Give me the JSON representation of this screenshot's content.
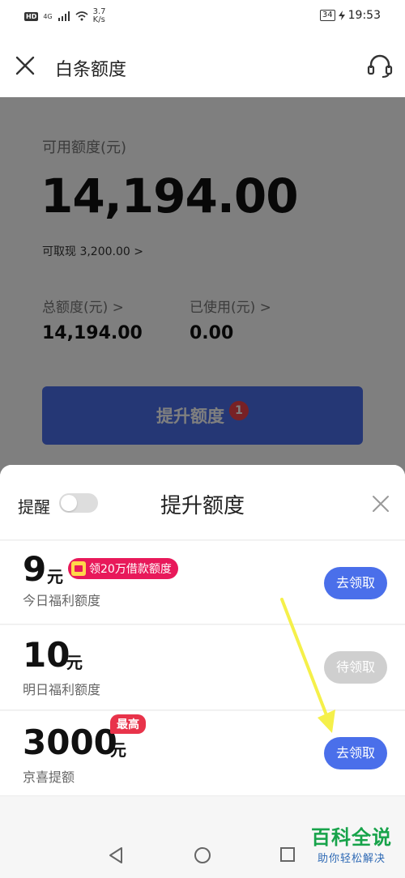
{
  "status_bar": {
    "hd": "HD",
    "network": "4G",
    "speed_value": "3.7",
    "speed_unit": "K/s",
    "battery": "34",
    "time": "19:53"
  },
  "header": {
    "title": "白条额度",
    "close_icon": "close-icon",
    "service_icon": "headset-icon"
  },
  "account": {
    "available_label": "可用额度(元)",
    "available_amount": "14,194.00",
    "cash_label": "可取现 3,200.00 >",
    "total_label": "总额度(元) >",
    "total_value": "14,194.00",
    "used_label": "已使用(元) >",
    "used_value": "0.00",
    "raise_button": "提升额度",
    "raise_badge": "1"
  },
  "sheet": {
    "remind_label": "提醒",
    "remind_on": false,
    "title": "提升额度",
    "rows": [
      {
        "amount": "9",
        "unit": "元",
        "tag": "领20万借款额度",
        "desc": "今日福利额度",
        "button": "去领取",
        "state": "active"
      },
      {
        "amount": "10",
        "unit": "元",
        "desc": "明日福利额度",
        "button": "待领取",
        "state": "pending"
      },
      {
        "amount": "3000",
        "unit": "元",
        "tag": "最高",
        "desc": "京喜提额",
        "button": "去领取",
        "state": "active"
      }
    ]
  },
  "watermark": {
    "main": "百科全说",
    "sub": "助你轻松解决"
  },
  "colors": {
    "accent": "#4a6fea",
    "badge": "#f0434a",
    "promo": "#e8195a",
    "pending": "#cfcfcf",
    "annotation_arrow": "#f5f04a"
  }
}
